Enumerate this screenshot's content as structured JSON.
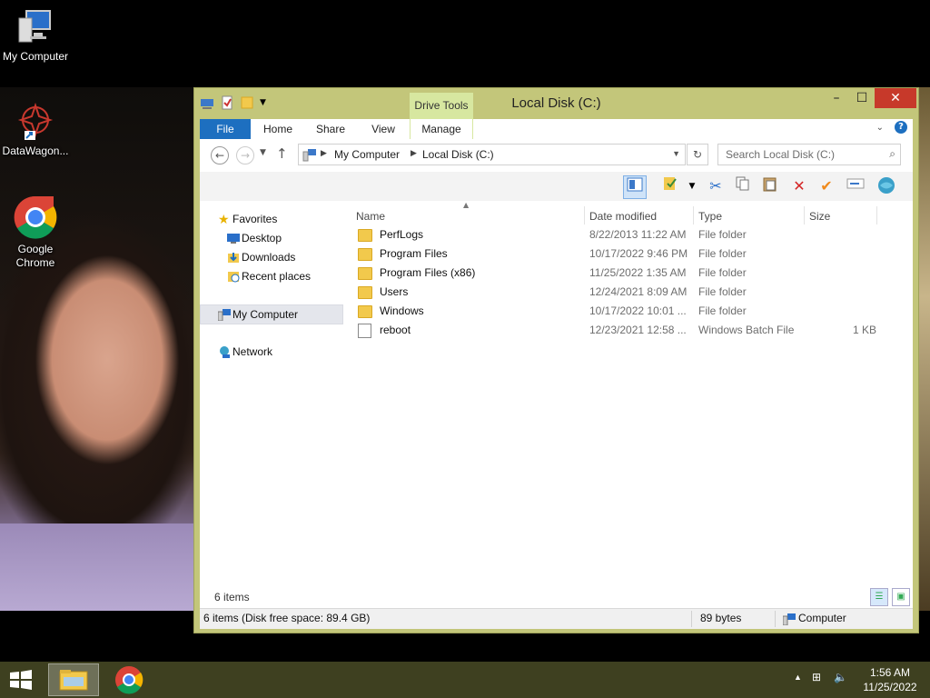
{
  "desktop": {
    "icons": [
      {
        "label": "My Computer",
        "icon": "computer-icon"
      },
      {
        "label": "DataWagon...",
        "icon": "datawagon-icon"
      },
      {
        "label": "Google Chrome",
        "icon": "chrome-icon"
      }
    ]
  },
  "window": {
    "title": "Local Disk (C:)",
    "drive_tools": "Drive Tools",
    "controls": {
      "minimize": "–",
      "maximize": "☐",
      "close": "✕"
    },
    "tabs": [
      "File",
      "Home",
      "Share",
      "View",
      "Manage"
    ],
    "address": {
      "crumbs": [
        "My Computer",
        "Local Disk (C:)"
      ]
    },
    "search": {
      "placeholder": "Search Local Disk (C:)"
    },
    "nav": {
      "favorites": "Favorites",
      "favorites_items": [
        "Desktop",
        "Downloads",
        "Recent places"
      ],
      "computer": "My Computer",
      "network": "Network"
    },
    "columns": {
      "name": "Name",
      "date": "Date modified",
      "type": "Type",
      "size": "Size"
    },
    "files": [
      {
        "name": "PerfLogs",
        "date": "8/22/2013 11:22 AM",
        "type": "File folder",
        "size": "",
        "kind": "folder"
      },
      {
        "name": "Program Files",
        "date": "10/17/2022 9:46 PM",
        "type": "File folder",
        "size": "",
        "kind": "folder"
      },
      {
        "name": "Program Files (x86)",
        "date": "11/25/2022 1:35 AM",
        "type": "File folder",
        "size": "",
        "kind": "folder"
      },
      {
        "name": "Users",
        "date": "12/24/2021 8:09 AM",
        "type": "File folder",
        "size": "",
        "kind": "folder"
      },
      {
        "name": "Windows",
        "date": "10/17/2022 10:01 ...",
        "type": "File folder",
        "size": "",
        "kind": "folder"
      },
      {
        "name": "reboot",
        "date": "12/23/2021 12:58 ...",
        "type": "Windows Batch File",
        "size": "1 KB",
        "kind": "batch"
      }
    ],
    "status": {
      "count": "6 items"
    },
    "details": {
      "free": "6 items (Disk free space: 89.4 GB)",
      "bytes": "89 bytes",
      "location": "Computer"
    }
  },
  "taskbar": {
    "time": "1:56 AM",
    "date": "11/25/2022"
  },
  "colors": {
    "window_frame": "#c3c67a",
    "file_tab": "#1d6fc0",
    "close_button": "#c7392a",
    "taskbar": "#3e4020"
  }
}
